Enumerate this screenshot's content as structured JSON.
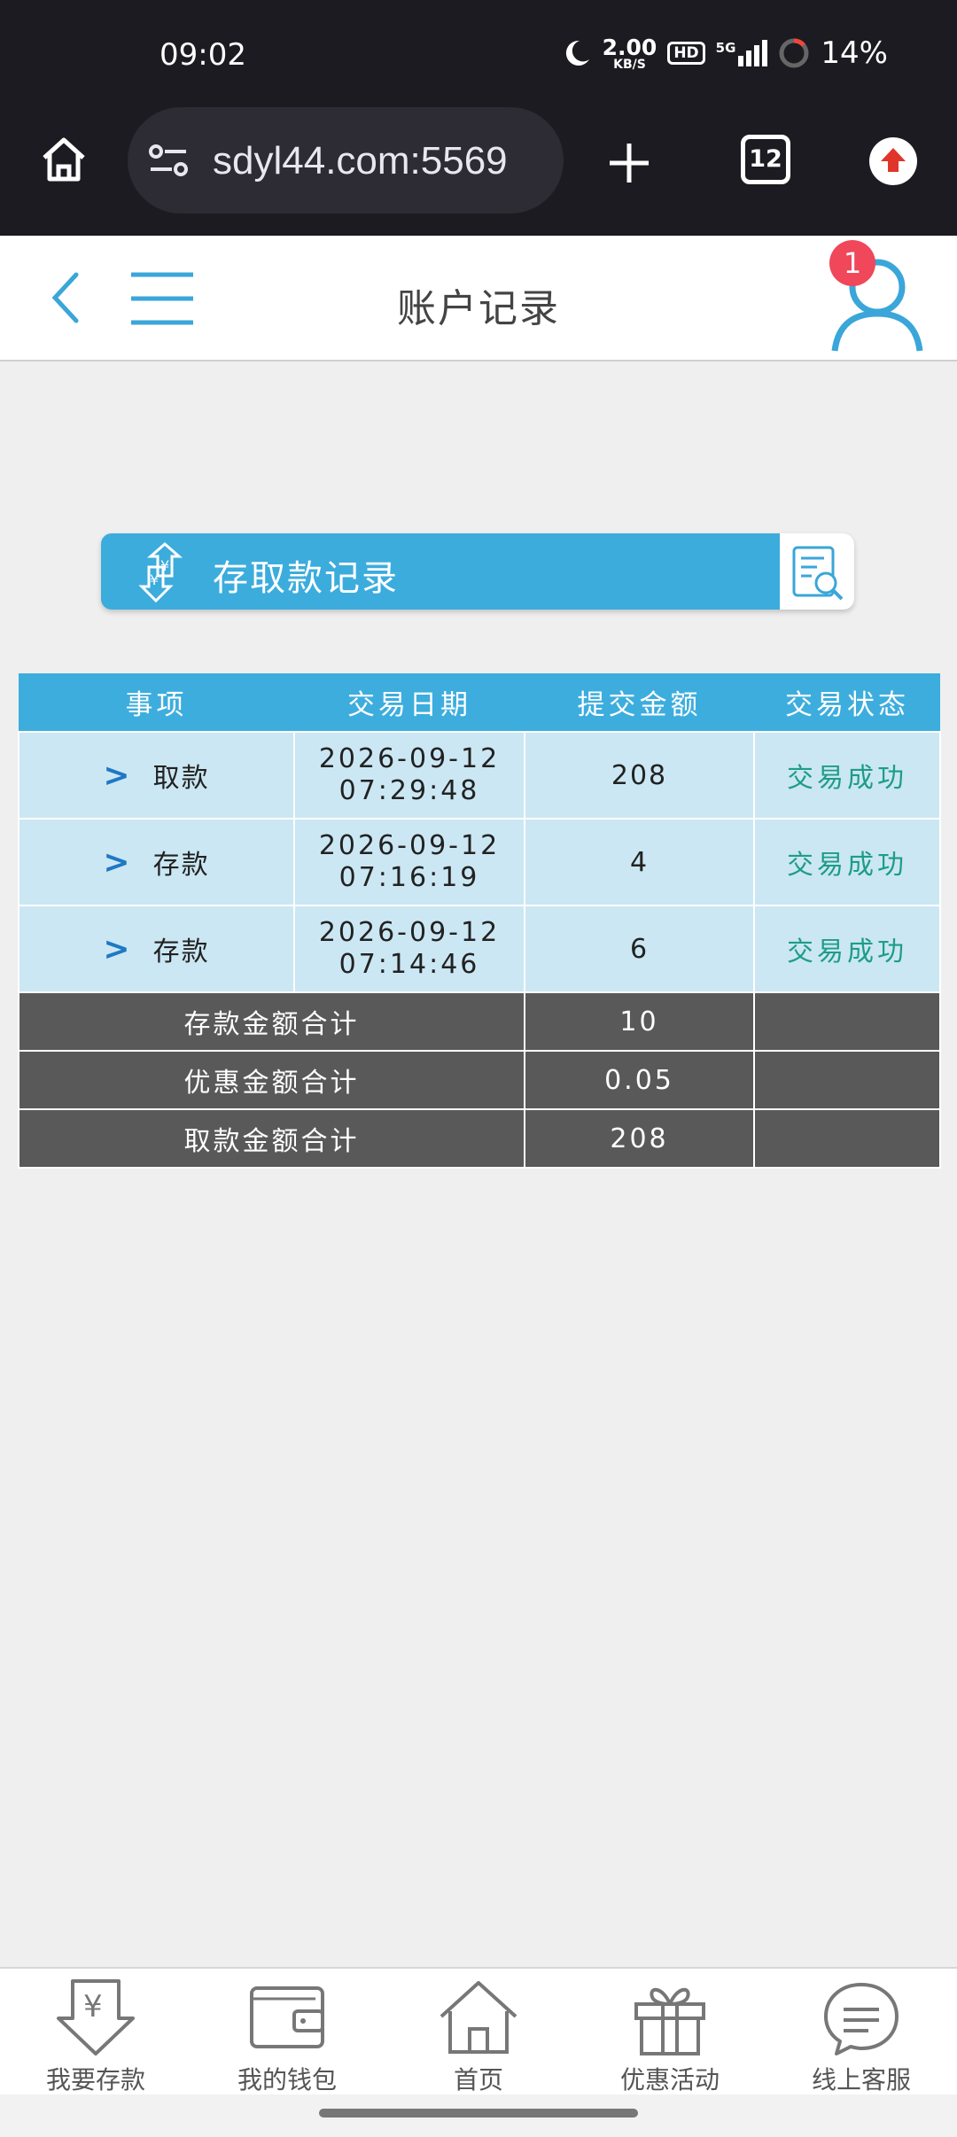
{
  "status_bar": {
    "time": "09:02",
    "net_speed": "2.00",
    "net_unit": "KB/S",
    "hd": "HD",
    "signal": "5G",
    "battery": "14%"
  },
  "browser": {
    "url": "sdyl44.com:5569",
    "tab_count": "12"
  },
  "header": {
    "title": "账户记录",
    "notification_count": "1"
  },
  "banner": {
    "title": "存取款记录"
  },
  "table": {
    "columns": [
      "事项",
      "交易日期",
      "提交金额",
      "交易状态"
    ],
    "rows": [
      {
        "item": "取款",
        "date": "2026-09-12",
        "time": "07:29:48",
        "amount": "208",
        "status": "交易成功"
      },
      {
        "item": "存款",
        "date": "2026-09-12",
        "time": "07:16:19",
        "amount": "4",
        "status": "交易成功"
      },
      {
        "item": "存款",
        "date": "2026-09-12",
        "time": "07:14:46",
        "amount": "6",
        "status": "交易成功"
      }
    ],
    "summary": [
      {
        "label": "存款金额合计",
        "value": "10"
      },
      {
        "label": "优惠金额合计",
        "value": "0.05"
      },
      {
        "label": "取款金额合计",
        "value": "208"
      }
    ]
  },
  "bottom_nav": [
    {
      "label": "我要存款",
      "icon": "deposit-icon"
    },
    {
      "label": "我的钱包",
      "icon": "wallet-icon"
    },
    {
      "label": "首页",
      "icon": "home-icon"
    },
    {
      "label": "优惠活动",
      "icon": "gift-icon"
    },
    {
      "label": "线上客服",
      "icon": "support-chat-icon"
    }
  ],
  "colors": {
    "accent": "#3cacdd",
    "success": "#1e9c8a",
    "summary_bg": "#595959",
    "badge": "#f0475a"
  }
}
